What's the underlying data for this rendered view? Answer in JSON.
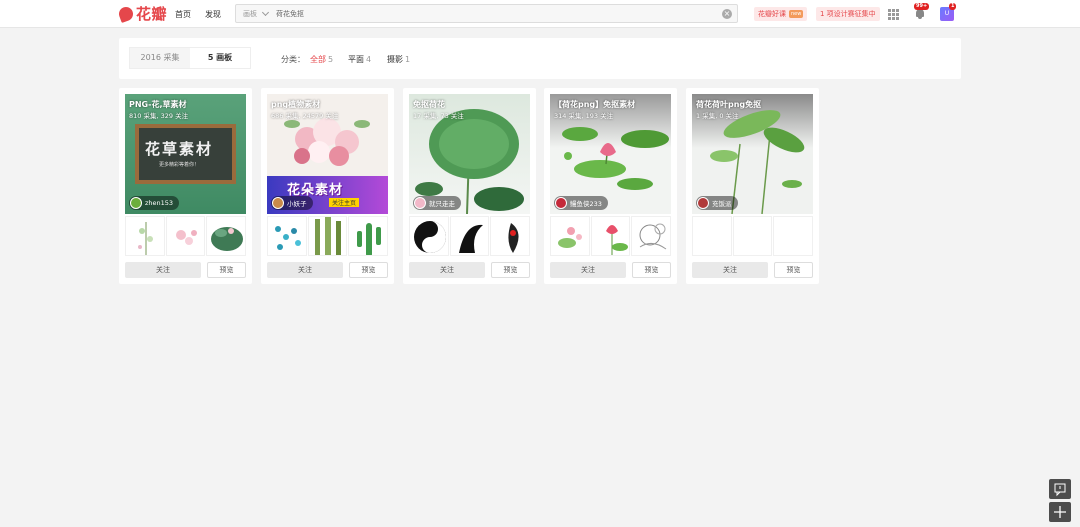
{
  "header": {
    "logo_text": "花瓣",
    "nav": [
      "首页",
      "发现"
    ],
    "search_scope": "画板",
    "search_query": "荷花免抠",
    "promo_course": "花瓣好课",
    "promo_course_badge": "new",
    "promo_contest": "1 项设计赛征集中",
    "notif_badge": "99+",
    "msg_badge": "1",
    "avatar_text": "U"
  },
  "filter": {
    "tabs": [
      {
        "label": "2016 采集",
        "active": false
      },
      {
        "label": "5 画板",
        "active": true
      }
    ],
    "category_label": "分类：",
    "categories": [
      {
        "label": "全部",
        "count": "5",
        "active": true
      },
      {
        "label": "平面",
        "count": "4",
        "active": false
      },
      {
        "label": "摄影",
        "count": "1",
        "active": false
      }
    ]
  },
  "boards": [
    {
      "title": "PNG-花,草素材",
      "meta": "810 采集, 329 关注",
      "owner": "zhen153",
      "cover_text": "花草素材",
      "cover_sub": "更多精彩等着你！",
      "follow": "关注",
      "preview": "预览"
    },
    {
      "title": "png植物素材",
      "meta": "686 采集, 24579 关注",
      "owner": "小妖子",
      "cover_text": "花朵素材",
      "cover_sub": "关注主页",
      "follow": "关注",
      "preview": "预览"
    },
    {
      "title": "免抠荷花",
      "meta": "17 采集, 73 关注",
      "owner": "就只走走",
      "follow": "关注",
      "preview": "预览"
    },
    {
      "title": "【荷花png】免抠素材",
      "meta": "314 采集, 193 关注",
      "owner": "鳗鱼侠233",
      "follow": "关注",
      "preview": "预览"
    },
    {
      "title": "荷花荷叶png免抠",
      "meta": "1 采集, 0 关注",
      "owner": "充饭派",
      "follow": "关注",
      "preview": "预览"
    }
  ],
  "colors": {
    "brand": "#e5474b",
    "page_bg": "#f3f3f3"
  },
  "floating": {
    "feedback_icon": "comment-icon",
    "add_icon": "plus-icon"
  }
}
